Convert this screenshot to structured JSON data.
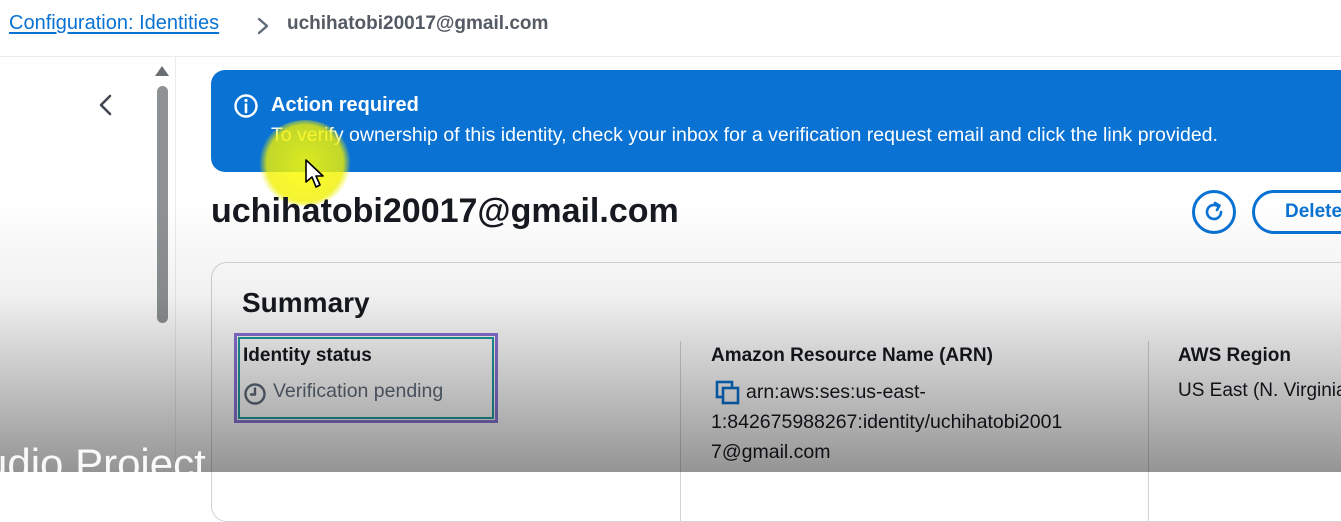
{
  "breadcrumb": {
    "parent_label": "Configuration: Identities",
    "current_label": "uchihatobi20017@gmail.com"
  },
  "alert": {
    "icon": "info-icon",
    "title": "Action required",
    "message": "To verify ownership of this identity, check your inbox for a verification request email and click the link provided."
  },
  "page": {
    "title": "uchihatobi20017@gmail.com",
    "refresh_icon": "refresh-icon",
    "delete_label": "Delete"
  },
  "summary": {
    "title": "Summary",
    "identity_status": {
      "label": "Identity status",
      "value": "Verification pending",
      "icon": "clock-icon"
    },
    "arn": {
      "label": "Amazon Resource Name (ARN)",
      "lines": [
        "arn:aws:ses:us-east-",
        "1:842675988267:identity/uchihatobi2001",
        "7@gmail.com"
      ],
      "icon": "copy-icon"
    },
    "region": {
      "label": "AWS Region",
      "value": "US East (N. Virginia)"
    }
  },
  "overlay": {
    "watermark_text": "udio Project"
  },
  "colors": {
    "accent": "#0972d3",
    "alert_bg": "#0972d3",
    "text_primary": "#16191f",
    "text_secondary": "#5f6b7a",
    "cursor_highlight": "#ffff00"
  }
}
